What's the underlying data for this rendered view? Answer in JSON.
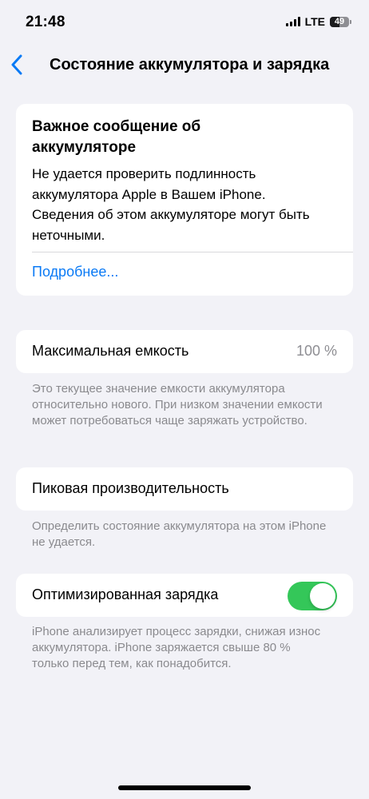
{
  "status_bar": {
    "time": "21:48",
    "network": "LTE",
    "battery_percent": "49",
    "battery_level": 0.49
  },
  "nav": {
    "title": "Состояние аккумулятора и зарядка",
    "back_icon": "chevron-left-icon"
  },
  "alert": {
    "title": "Важное сообщение об аккумуляторе",
    "body": "Не удается проверить подлинность аккумулятора Apple в Вашем iPhone. Сведения об этом аккумуляторе могут быть неточными.",
    "link": "Подробнее..."
  },
  "capacity": {
    "label": "Максимальная емкость",
    "value": "100 %",
    "footnote": "Это текущее значение емкости аккумулятора относительно нового. При низком значении емкости может потребоваться чаще заряжать устройство."
  },
  "peak": {
    "label": "Пиковая производительность",
    "footnote": "Определить состояние аккумулятора на этом iPhone не удается."
  },
  "optimized": {
    "label": "Оптимизированная зарядка",
    "enabled": true,
    "footnote": "iPhone анализирует процесс зарядки, снижая износ аккумулятора. iPhone заряжается свыше 80 % только перед тем, как понадобится."
  },
  "colors": {
    "background": "#f2f2f7",
    "link": "#0a7af5",
    "toggle_on": "#34c759",
    "secondary_text": "#8e8e93"
  }
}
